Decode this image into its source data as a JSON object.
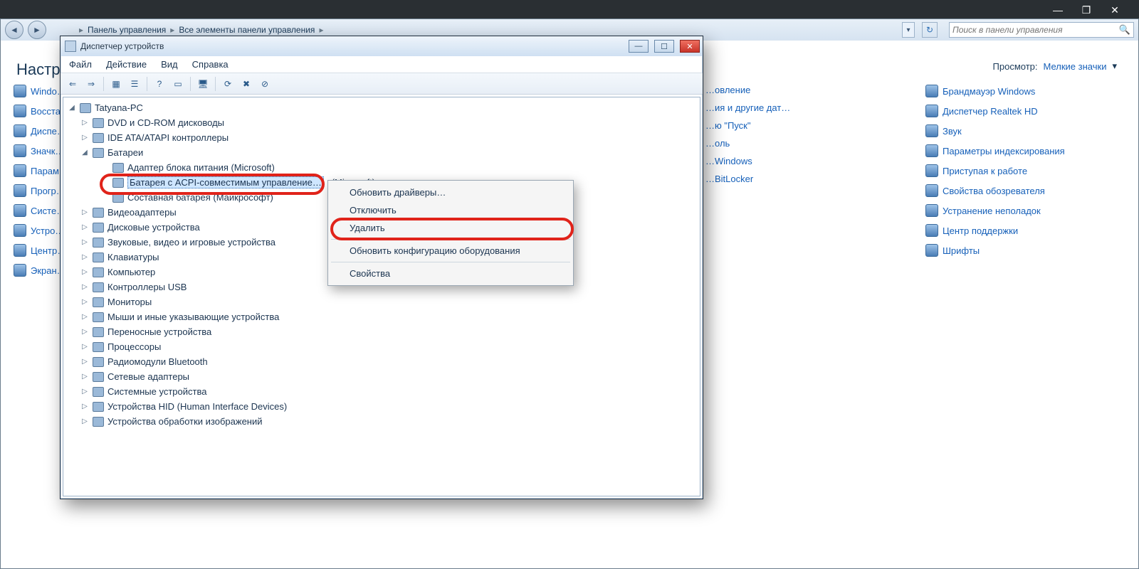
{
  "parent_chrome": {
    "min": "—",
    "restore": "❐",
    "close": "✕"
  },
  "explorer": {
    "breadcrumb": [
      "Панель управления",
      "Все элементы панели управления"
    ],
    "search_placeholder": "Поиск в панели управления",
    "heading": "Настро",
    "view_label": "Просмотр:",
    "view_value": "Мелкие значки",
    "left_col": [
      "Windo…",
      "Восста…",
      "Диспе…",
      "Значк…",
      "Парам…",
      "Прогр…",
      "Систе…",
      "Устро…",
      "Центр…",
      "Экран…"
    ],
    "mid_col": [
      "…овление",
      "…ия и другие дат…",
      "…ю \"Пуск\"",
      "…оль",
      "…Windows",
      "…BitLocker"
    ],
    "right_col": [
      "Брандмауэр Windows",
      "Диспетчер Realtek HD",
      "Звук",
      "Параметры индексирования",
      "Приступая к работе",
      "Свойства обозревателя",
      "Устранение неполадок",
      "Центр поддержки",
      "Шрифты"
    ]
  },
  "devmgr": {
    "title": "Диспетчер устройств",
    "menu": [
      "Файл",
      "Действие",
      "Вид",
      "Справка"
    ],
    "root": "Tatyana-PC",
    "cat": {
      "dvd": "DVD и CD-ROM дисководы",
      "ide": "IDE ATA/ATAPI контроллеры",
      "bat": "Батареи",
      "bat_children": {
        "adapter": "Адаптер блока питания (Microsoft)",
        "acpi": "Батарея с ACPI-совместимым управление…",
        "acpi_tail": "(Microsoft)",
        "compound": "Составная батарея (Майкрософт)"
      },
      "video": "Видеоадаптеры",
      "disk": "Дисковые устройства",
      "sound": "Звуковые, видео и игровые устройства",
      "keyb": "Клавиатуры",
      "comp": "Компьютер",
      "usb": "Контроллеры USB",
      "mon": "Мониторы",
      "mouse": "Мыши и иные указывающие устройства",
      "portable": "Переносные устройства",
      "cpu": "Процессоры",
      "bt": "Радиомодули Bluetooth",
      "net": "Сетевые адаптеры",
      "sys": "Системные устройства",
      "hid": "Устройства HID (Human Interface Devices)",
      "img": "Устройства обработки изображений"
    }
  },
  "ctx": {
    "update": "Обновить драйверы…",
    "disable": "Отключить",
    "delete": "Удалить",
    "scan": "Обновить конфигурацию оборудования",
    "props": "Свойства"
  }
}
